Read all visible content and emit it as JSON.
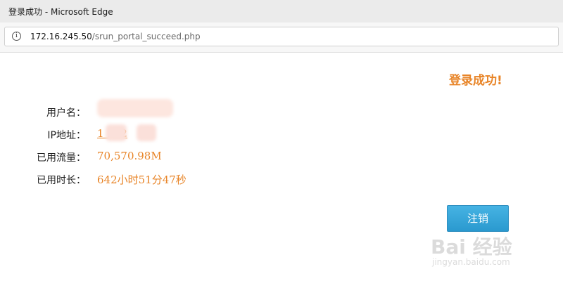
{
  "window": {
    "title": "登录成功 - Microsoft Edge"
  },
  "addressbar": {
    "url_host": "172.16.245.50",
    "url_path": "/srun_portal_succeed.php",
    "info_icon": "info-icon"
  },
  "page": {
    "success_message": "登录成功!",
    "rows": [
      {
        "label": "用户名：",
        "value": ""
      },
      {
        "label": "IP地址：",
        "value": "1  .1  2"
      },
      {
        "label": "已用流量：",
        "value": "70,570.98M"
      },
      {
        "label": "已用时长：",
        "value": "642小时51分47秒"
      }
    ],
    "logout_label": "注销"
  },
  "watermark": {
    "main": "Bai 经验",
    "sub": "jingyan.baidu.com"
  },
  "colors": {
    "accent_orange": "#e88427",
    "button_blue": "#2a99cf",
    "titlebar_bg": "#ebebeb"
  }
}
